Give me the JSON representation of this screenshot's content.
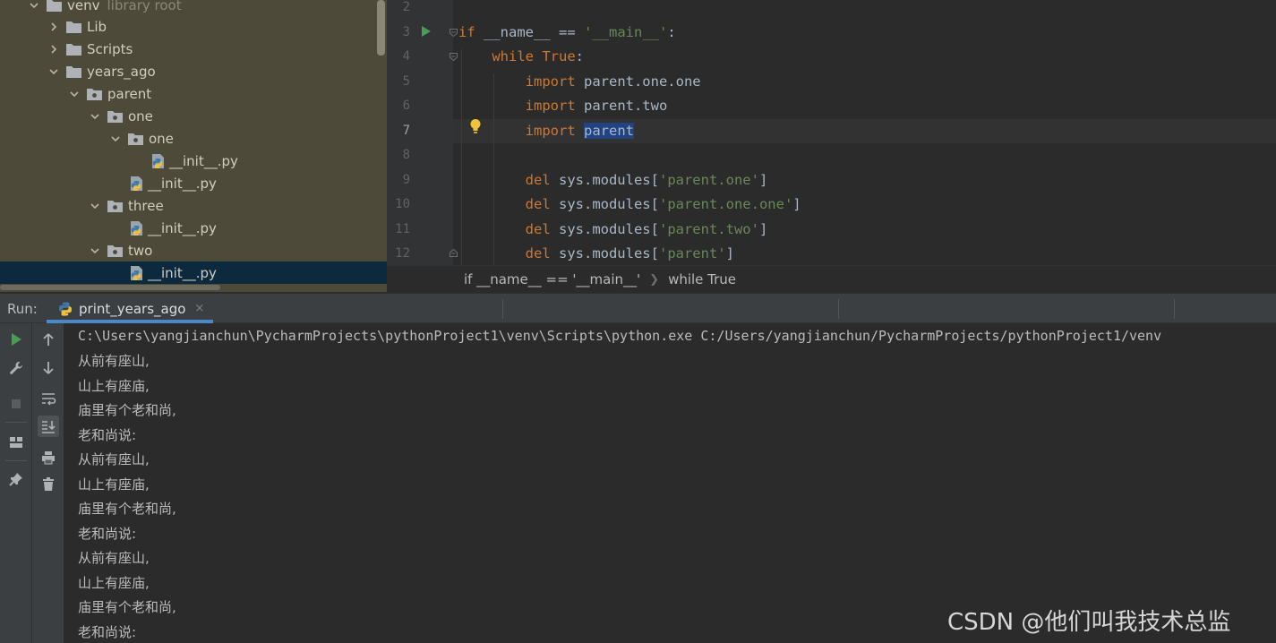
{
  "project_tree": {
    "items": [
      {
        "name": "venv",
        "suffix": "library root",
        "kind": "folder",
        "expanded": true
      },
      {
        "name": "Lib",
        "kind": "folder",
        "expanded": false
      },
      {
        "name": "Scripts",
        "kind": "folder",
        "expanded": false
      },
      {
        "name": "years_ago",
        "kind": "folder",
        "expanded": true
      },
      {
        "name": "parent",
        "kind": "package",
        "expanded": true
      },
      {
        "name": "one",
        "kind": "package",
        "expanded": true
      },
      {
        "name": "one",
        "kind": "package",
        "expanded": true
      },
      {
        "name": "__init__.py",
        "kind": "python-file"
      },
      {
        "name": "__init__.py",
        "kind": "python-file"
      },
      {
        "name": "three",
        "kind": "package",
        "expanded": true
      },
      {
        "name": "__init__.py",
        "kind": "python-file"
      },
      {
        "name": "two",
        "kind": "package",
        "expanded": true
      },
      {
        "name": "__init__.py",
        "kind": "python-file",
        "selected": true
      }
    ]
  },
  "editor": {
    "current_line": "7",
    "lines": [
      {
        "num": "2",
        "parts": []
      },
      {
        "num": "3",
        "parts": [
          {
            "t": "if",
            "c": "kw"
          },
          {
            "t": " __name__ == "
          },
          {
            "t": "'__main__'",
            "c": "str"
          },
          {
            "t": ":"
          }
        ]
      },
      {
        "num": "4",
        "parts": [
          {
            "t": "    "
          },
          {
            "t": "while",
            "c": "kw"
          },
          {
            "t": " "
          },
          {
            "t": "True",
            "c": "kw"
          },
          {
            "t": ":"
          }
        ]
      },
      {
        "num": "5",
        "parts": [
          {
            "t": "        "
          },
          {
            "t": "import",
            "c": "kw"
          },
          {
            "t": " parent.one.one"
          }
        ]
      },
      {
        "num": "6",
        "parts": [
          {
            "t": "        "
          },
          {
            "t": "import",
            "c": "kw"
          },
          {
            "t": " parent.two"
          }
        ]
      },
      {
        "num": "7",
        "parts": [
          {
            "t": "        "
          },
          {
            "t": "import",
            "c": "kw"
          },
          {
            "t": " "
          },
          {
            "t": "parent",
            "c": "hl"
          }
        ]
      },
      {
        "num": "8",
        "parts": []
      },
      {
        "num": "9",
        "parts": [
          {
            "t": "        "
          },
          {
            "t": "del",
            "c": "kw"
          },
          {
            "t": " sys.modules["
          },
          {
            "t": "'parent.one'",
            "c": "str"
          },
          {
            "t": "]"
          }
        ]
      },
      {
        "num": "10",
        "parts": [
          {
            "t": "        "
          },
          {
            "t": "del",
            "c": "kw"
          },
          {
            "t": " sys.modules["
          },
          {
            "t": "'parent.one.one'",
            "c": "str"
          },
          {
            "t": "]"
          }
        ]
      },
      {
        "num": "11",
        "parts": [
          {
            "t": "        "
          },
          {
            "t": "del",
            "c": "kw"
          },
          {
            "t": " sys.modules["
          },
          {
            "t": "'parent.two'",
            "c": "str"
          },
          {
            "t": "]"
          }
        ]
      },
      {
        "num": "12",
        "parts": [
          {
            "t": "        "
          },
          {
            "t": "del",
            "c": "kw"
          },
          {
            "t": " sys.modules["
          },
          {
            "t": "'parent'",
            "c": "str"
          },
          {
            "t": "]"
          }
        ]
      }
    ]
  },
  "breadcrumb": {
    "first": "if __name__ == '__main__'",
    "second": "while True"
  },
  "run_panel": {
    "label": "Run:",
    "tab_label": "print_years_ago",
    "tab_close": "×",
    "accent_color": "#4a88c7",
    "toolbar_icons": [
      "rerun-icon",
      "wrench-icon",
      "stop-icon",
      "layout-icon",
      "pin-icon",
      "up-arrow-icon",
      "down-arrow-icon",
      "soft-wrap-icon",
      "scroll-to-end-icon",
      "print-icon",
      "trash-icon"
    ]
  },
  "console": {
    "command": "C:\\Users\\yangjianchun\\PycharmProjects\\pythonProject1\\venv\\Scripts\\python.exe C:/Users/yangjianchun/PycharmProjects/pythonProject1/venv",
    "output": [
      "从前有座山,",
      "山上有座庙,",
      "庙里有个老和尚,",
      "老和尚说:",
      "从前有座山,",
      "山上有座庙,",
      "庙里有个老和尚,",
      "老和尚说:",
      "从前有座山,",
      "山上有座庙,",
      "庙里有个老和尚,",
      "老和尚说:"
    ]
  },
  "watermark": "CSDN @他们叫我技术总监"
}
